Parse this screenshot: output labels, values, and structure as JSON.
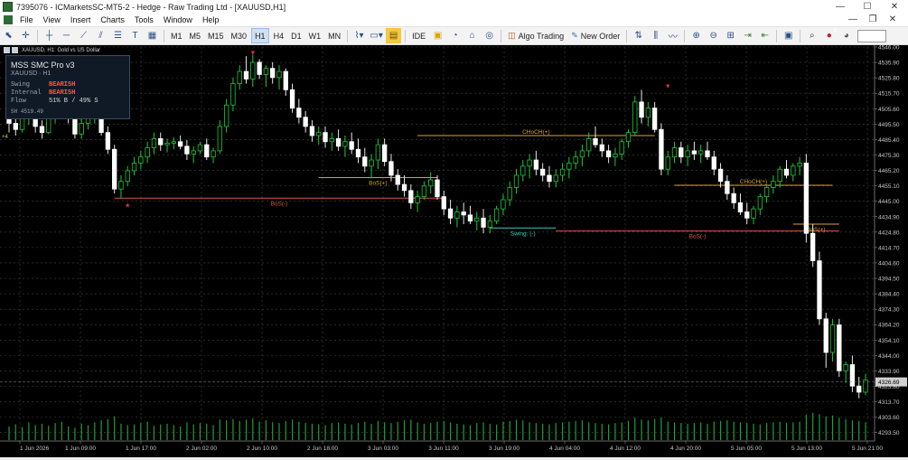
{
  "window": {
    "title": "7395076 - ICMarketsSC-MT5-2 - Hedge - Raw Trading Ltd - [XAUUSD,H1]",
    "min": "—",
    "max": "☐",
    "close": "✕"
  },
  "menu": {
    "items": [
      "File",
      "View",
      "Insert",
      "Charts",
      "Tools",
      "Window",
      "Help"
    ],
    "child_min": "—",
    "child_max": "❐",
    "child_close": "✕"
  },
  "toolbar": {
    "timeframes": [
      "M1",
      "M5",
      "M15",
      "M30",
      "H1",
      "H4",
      "D1",
      "W1",
      "MN"
    ],
    "active_timeframe": "H1",
    "ide": "IDE",
    "algo": "Algo Trading",
    "order": "New Order",
    "notif_badge": "1"
  },
  "chart": {
    "symbol_header": "XAUUSD, H1:  Gold vs US Dollar",
    "price_labels": [
      "4546.00",
      "4535.90",
      "4525.80",
      "4515.70",
      "4505.60",
      "4495.50",
      "4485.40",
      "4475.30",
      "4465.20",
      "4455.10",
      "4445.00",
      "4434.90",
      "4424.80",
      "4414.70",
      "4404.60",
      "4394.50",
      "4384.40",
      "4374.30",
      "4364.20",
      "4354.10",
      "4344.00",
      "4333.90",
      "4323.80",
      "4313.70",
      "4303.60",
      "4293.50"
    ],
    "price_top": 4546.0,
    "price_bottom": 4288.0,
    "current_price": "4326.69",
    "current_price_value": 4326.69,
    "time_labels": [
      "1 Jun 2026",
      "1 Jun 09:00",
      "1 Jun 17:00",
      "2 Jun 02:00",
      "2 Jun 10:00",
      "2 Jun 18:00",
      "3 Jun 03:00",
      "3 Jun 11:00",
      "3 Jun 19:00",
      "4 Jun 04:00",
      "4 Jun 12:00",
      "4 Jun 20:00",
      "5 Jun 05:00",
      "5 Jun 13:00",
      "5 Jun 21:00"
    ],
    "left_marker": "+4",
    "structure": [
      {
        "label": "BoS(-)",
        "price": 4447.0,
        "from": 16,
        "to": 66,
        "color": "#e0524a"
      },
      {
        "label": "BoS(+)",
        "price": 4460.5,
        "from": 47,
        "to": 65,
        "color": "#d8a32d"
      },
      {
        "label": "CHoCH(+)",
        "price": 4488.0,
        "from": 62,
        "to": 98,
        "color": "#d8a32d"
      },
      {
        "label": "CHoCH(+)",
        "price": 4455.5,
        "from": 101,
        "to": 125,
        "color": "#d8a32d"
      },
      {
        "label": "Swing: (-)",
        "price": 4427.5,
        "from": 73,
        "to": 83,
        "color": "#35d0c2"
      },
      {
        "label": "BoS(-)",
        "price": 4425.5,
        "from": 83,
        "to": 126,
        "color": "#e0524a"
      },
      {
        "label": "BoS(+)",
        "price": 4430.0,
        "from": 119,
        "to": 126,
        "color": "#d8a32d"
      }
    ],
    "arrows": [
      {
        "candle": 37,
        "price": 4541.0,
        "symbol": "▼"
      },
      {
        "candle": 100,
        "price": 4519.0,
        "symbol": "▼"
      },
      {
        "candle": 18,
        "price": 4441.0,
        "symbol": "★"
      }
    ]
  },
  "chart_data": {
    "type": "candlestick",
    "symbol": "XAUUSD",
    "timeframe": "H1",
    "ohlc": [
      [
        4510,
        4512,
        4490,
        4496
      ],
      [
        4496,
        4500,
        4488,
        4492
      ],
      [
        4492,
        4505,
        4490,
        4500
      ],
      [
        4500,
        4508,
        4495,
        4503
      ],
      [
        4503,
        4506,
        4490,
        4494
      ],
      [
        4494,
        4498,
        4486,
        4490
      ],
      [
        4490,
        4505,
        4489,
        4501
      ],
      [
        4501,
        4510,
        4496,
        4505
      ],
      [
        4505,
        4514,
        4502,
        4509
      ],
      [
        4509,
        4512,
        4496,
        4499
      ],
      [
        4499,
        4503,
        4486,
        4489
      ],
      [
        4489,
        4500,
        4486,
        4496
      ],
      [
        4496,
        4506,
        4492,
        4500
      ],
      [
        4500,
        4510,
        4496,
        4506
      ],
      [
        4506,
        4508,
        4488,
        4490
      ],
      [
        4490,
        4494,
        4476,
        4479
      ],
      [
        4479,
        4482,
        4450,
        4453
      ],
      [
        4453,
        4462,
        4447,
        4458
      ],
      [
        4458,
        4468,
        4455,
        4465
      ],
      [
        4465,
        4474,
        4462,
        4470
      ],
      [
        4470,
        4478,
        4466,
        4474
      ],
      [
        4474,
        4484,
        4470,
        4480
      ],
      [
        4480,
        4490,
        4476,
        4486
      ],
      [
        4486,
        4490,
        4478,
        4482
      ],
      [
        4482,
        4486,
        4477,
        4483
      ],
      [
        4483,
        4487,
        4479,
        4484
      ],
      [
        4484,
        4488,
        4479,
        4481
      ],
      [
        4481,
        4485,
        4472,
        4476
      ],
      [
        4476,
        4481,
        4470,
        4478
      ],
      [
        4478,
        4484,
        4476,
        4482
      ],
      [
        4482,
        4486,
        4472,
        4474
      ],
      [
        4474,
        4480,
        4470,
        4478
      ],
      [
        4478,
        4498,
        4476,
        4494
      ],
      [
        4494,
        4512,
        4490,
        4508
      ],
      [
        4508,
        4526,
        4504,
        4522
      ],
      [
        4522,
        4534,
        4518,
        4530
      ],
      [
        4530,
        4540,
        4522,
        4525
      ],
      [
        4525,
        4541,
        4520,
        4536
      ],
      [
        4536,
        4538,
        4525,
        4528
      ],
      [
        4528,
        4534,
        4520,
        4532
      ],
      [
        4532,
        4536,
        4522,
        4526
      ],
      [
        4526,
        4534,
        4518,
        4530
      ],
      [
        4530,
        4532,
        4514,
        4518
      ],
      [
        4518,
        4522,
        4503,
        4506
      ],
      [
        4506,
        4512,
        4496,
        4500
      ],
      [
        4500,
        4504,
        4490,
        4494
      ],
      [
        4494,
        4498,
        4484,
        4488
      ],
      [
        4488,
        4494,
        4482,
        4490
      ],
      [
        4490,
        4494,
        4480,
        4484
      ],
      [
        4484,
        4490,
        4478,
        4486
      ],
      [
        4486,
        4492,
        4478,
        4481
      ],
      [
        4481,
        4488,
        4474,
        4484
      ],
      [
        4484,
        4490,
        4476,
        4479
      ],
      [
        4479,
        4486,
        4470,
        4474
      ],
      [
        4474,
        4480,
        4464,
        4468
      ],
      [
        4468,
        4476,
        4460,
        4472
      ],
      [
        4472,
        4486,
        4466,
        4482
      ],
      [
        4482,
        4486,
        4468,
        4471
      ],
      [
        4471,
        4476,
        4458,
        4462
      ],
      [
        4462,
        4466,
        4452,
        4456
      ],
      [
        4456,
        4462,
        4448,
        4452
      ],
      [
        4452,
        4456,
        4440,
        4444
      ],
      [
        4444,
        4452,
        4438,
        4448
      ],
      [
        4448,
        4458,
        4446,
        4455
      ],
      [
        4455,
        4464,
        4450,
        4459
      ],
      [
        4459,
        4462,
        4446,
        4448
      ],
      [
        4448,
        4452,
        4436,
        4440
      ],
      [
        4440,
        4446,
        4430,
        4434
      ],
      [
        4434,
        4442,
        4428,
        4438
      ],
      [
        4438,
        4444,
        4430,
        4436
      ],
      [
        4436,
        4442,
        4430,
        4432
      ],
      [
        4432,
        4438,
        4426,
        4434
      ],
      [
        4434,
        4440,
        4424,
        4428
      ],
      [
        4428,
        4436,
        4424,
        4432
      ],
      [
        4432,
        4442,
        4430,
        4440
      ],
      [
        4440,
        4450,
        4436,
        4446
      ],
      [
        4446,
        4458,
        4442,
        4454
      ],
      [
        4454,
        4466,
        4450,
        4462
      ],
      [
        4462,
        4472,
        4458,
        4468
      ],
      [
        4468,
        4476,
        4460,
        4472
      ],
      [
        4472,
        4478,
        4462,
        4466
      ],
      [
        4466,
        4470,
        4458,
        4462
      ],
      [
        4462,
        4468,
        4454,
        4458
      ],
      [
        4458,
        4466,
        4454,
        4462
      ],
      [
        4462,
        4470,
        4458,
        4466
      ],
      [
        4466,
        4474,
        4460,
        4470
      ],
      [
        4470,
        4478,
        4466,
        4474
      ],
      [
        4474,
        4482,
        4468,
        4478
      ],
      [
        4478,
        4490,
        4474,
        4486
      ],
      [
        4486,
        4494,
        4480,
        4482
      ],
      [
        4482,
        4486,
        4474,
        4478
      ],
      [
        4478,
        4482,
        4470,
        4474
      ],
      [
        4474,
        4480,
        4468,
        4476
      ],
      [
        4476,
        4486,
        4472,
        4484
      ],
      [
        4484,
        4492,
        4480,
        4490
      ],
      [
        4490,
        4514,
        4488,
        4510
      ],
      [
        4510,
        4518,
        4496,
        4500
      ],
      [
        4500,
        4510,
        4494,
        4506
      ],
      [
        4506,
        4510,
        4490,
        4492
      ],
      [
        4492,
        4496,
        4462,
        4466
      ],
      [
        4466,
        4478,
        4462,
        4474
      ],
      [
        4474,
        4484,
        4470,
        4480
      ],
      [
        4480,
        4484,
        4470,
        4474
      ],
      [
        4474,
        4482,
        4468,
        4478
      ],
      [
        4478,
        4484,
        4472,
        4476
      ],
      [
        4476,
        4482,
        4470,
        4478
      ],
      [
        4478,
        4484,
        4472,
        4474
      ],
      [
        4474,
        4478,
        4462,
        4466
      ],
      [
        4466,
        4470,
        4454,
        4458
      ],
      [
        4458,
        4462,
        4446,
        4450
      ],
      [
        4450,
        4454,
        4440,
        4444
      ],
      [
        4444,
        4450,
        4436,
        4438
      ],
      [
        4438,
        4444,
        4430,
        4434
      ],
      [
        4434,
        4442,
        4430,
        4440
      ],
      [
        4440,
        4450,
        4436,
        4448
      ],
      [
        4448,
        4456,
        4444,
        4454
      ],
      [
        4454,
        4462,
        4450,
        4458
      ],
      [
        4458,
        4468,
        4454,
        4466
      ],
      [
        4466,
        4472,
        4460,
        4462
      ],
      [
        4462,
        4470,
        4458,
        4468
      ],
      [
        4468,
        4474,
        4462,
        4470
      ],
      [
        4470,
        4476,
        4418,
        4424
      ],
      [
        4424,
        4430,
        4402,
        4406
      ],
      [
        4406,
        4412,
        4364,
        4368
      ],
      [
        4368,
        4372,
        4336,
        4346
      ],
      [
        4346,
        4368,
        4340,
        4364
      ],
      [
        4364,
        4368,
        4330,
        4334
      ],
      [
        4334,
        4340,
        4326,
        4338
      ],
      [
        4338,
        4344,
        4320,
        4324
      ],
      [
        4324,
        4330,
        4316,
        4320
      ],
      [
        4320,
        4332,
        4318,
        4328
      ]
    ],
    "volume": [
      40,
      46,
      38,
      52,
      44,
      48,
      42,
      50,
      54,
      40,
      36,
      48,
      44,
      52,
      58,
      62,
      70,
      48,
      44,
      46,
      50,
      54,
      42,
      46,
      48,
      44,
      40,
      52,
      46,
      50,
      48,
      44,
      60,
      58,
      62,
      56,
      60,
      64,
      54,
      58,
      52,
      50,
      56,
      60,
      54,
      50,
      48,
      46,
      44,
      50,
      52,
      48,
      46,
      50,
      54,
      48,
      56,
      52,
      50,
      54,
      58,
      60,
      52,
      48,
      50,
      54,
      56,
      52,
      48,
      46,
      44,
      50,
      52,
      48,
      46,
      54,
      56,
      60,
      58,
      52,
      50,
      48,
      46,
      50,
      52,
      54,
      56,
      58,
      52,
      50,
      48,
      46,
      50,
      52,
      56,
      66,
      60,
      58,
      62,
      66,
      54,
      52,
      50,
      48,
      50,
      52,
      48,
      54,
      56,
      58,
      54,
      52,
      50,
      48,
      46,
      50,
      52,
      54,
      50,
      52,
      54,
      74,
      80,
      76,
      70,
      72,
      66,
      62,
      58,
      56,
      52
    ],
    "ylim": [
      4288,
      4546
    ]
  }
}
